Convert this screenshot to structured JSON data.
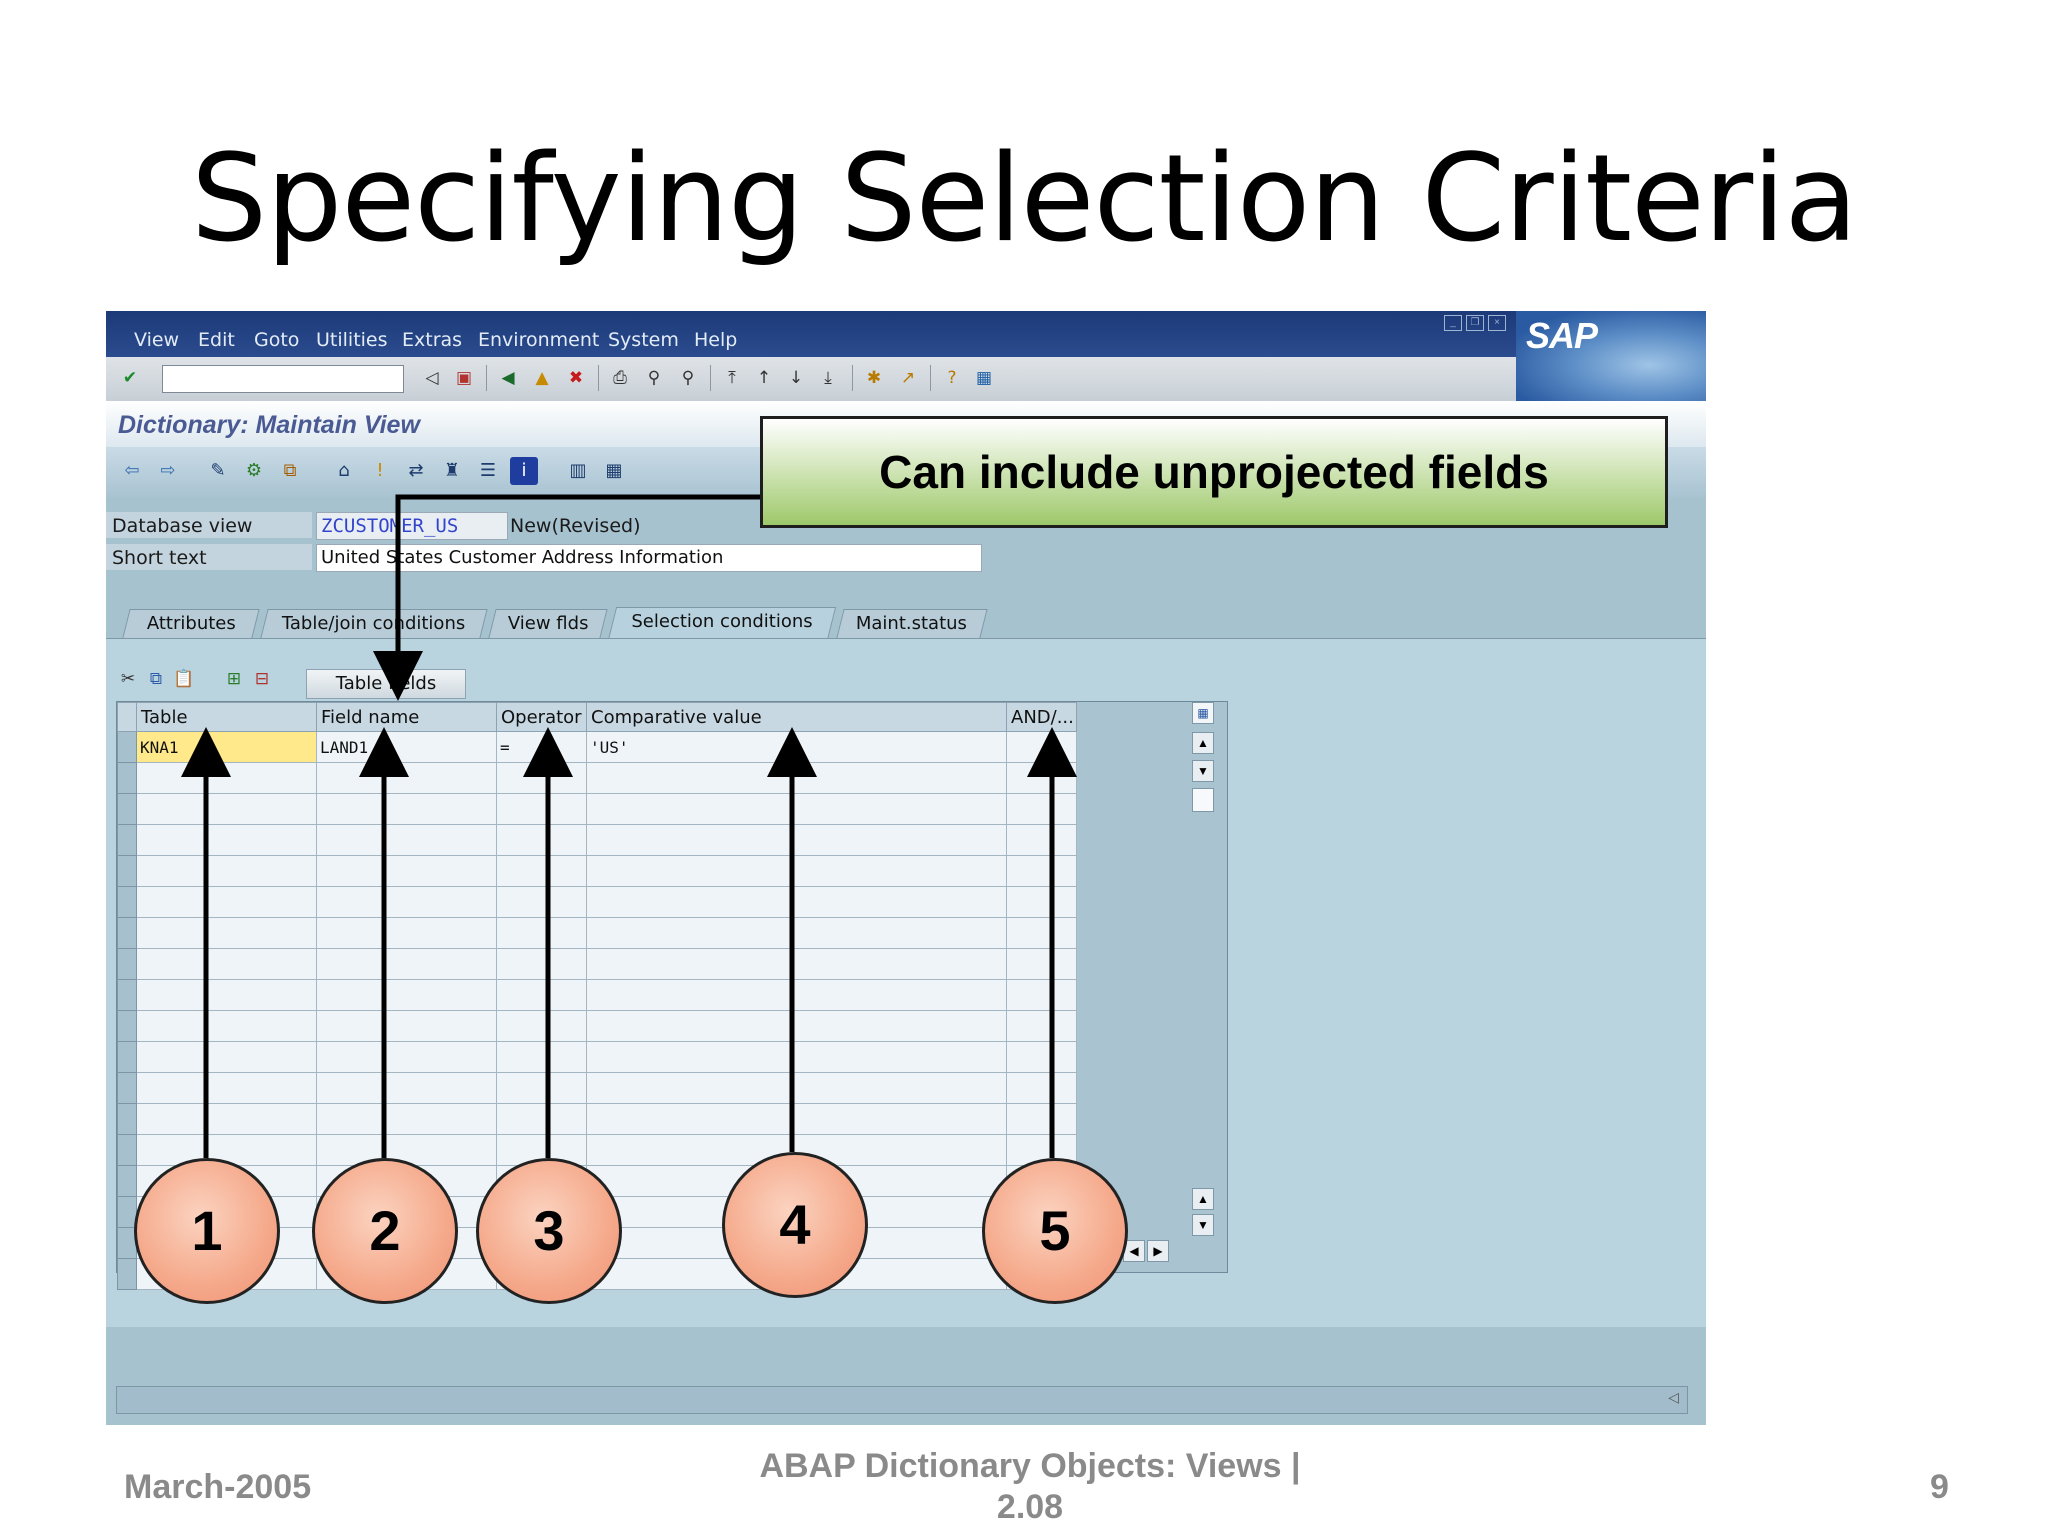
{
  "slide": {
    "title": "Specifying Selection Criteria",
    "footer_date": "March-2005",
    "footer_title_line1": "ABAP Dictionary Objects:  Views |",
    "footer_title_line2": "2.08",
    "page_number": "9"
  },
  "menubar": {
    "items": [
      "View",
      "Edit",
      "Goto",
      "Utilities",
      "Extras",
      "Environment",
      "System",
      "Help"
    ],
    "logo": "SAP"
  },
  "screen": {
    "title": "Dictionary: Maintain View",
    "database_view_label": "Database view",
    "database_view_value": "ZCUSTOMER_US",
    "status": "New(Revised)",
    "short_text_label": "Short text",
    "short_text_value": "United States Customer Address Information"
  },
  "tabs": [
    {
      "label": "Attributes",
      "active": false
    },
    {
      "label": "Table/join conditions",
      "active": false
    },
    {
      "label": "View flds",
      "active": false
    },
    {
      "label": "Selection conditions",
      "active": true
    },
    {
      "label": "Maint.status",
      "active": false
    }
  ],
  "grid": {
    "table_fields_button": "Table fields",
    "columns": [
      "Table",
      "Field name",
      "Operator",
      "Comparative value",
      "AND/..."
    ],
    "rows": [
      {
        "table": "KNA1",
        "field": "LAND1",
        "operator": "=",
        "value": "'US'",
        "andor": ""
      }
    ]
  },
  "annotations": {
    "callout": "Can include unprojected fields",
    "markers": [
      "1",
      "2",
      "3",
      "4",
      "5"
    ]
  },
  "colors": {
    "menubar": "#1d3a78",
    "window_bg": "#a7c2cf",
    "callout_green": "#9ec96a",
    "marker_fill": "#f5a98b",
    "highlight_cell": "#ffe98a"
  }
}
